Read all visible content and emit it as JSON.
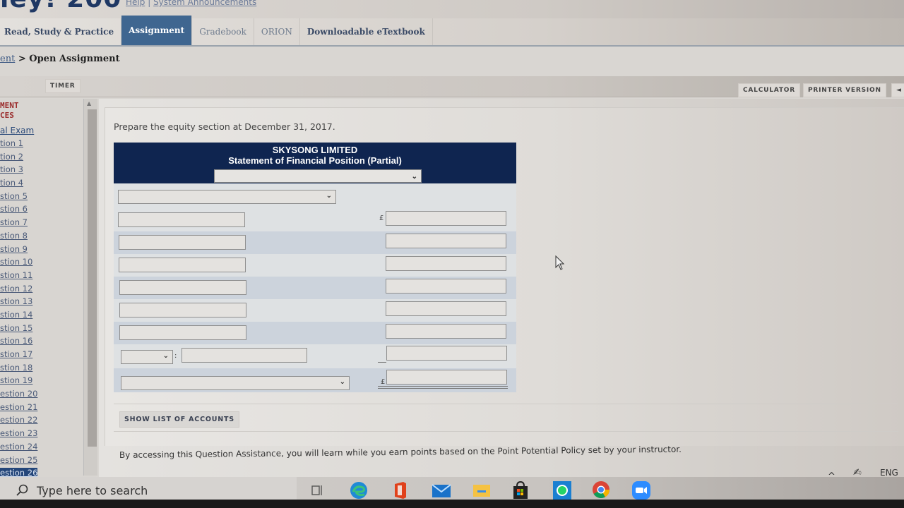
{
  "header": {
    "brand_partial": "ley! 200",
    "links": [
      "Help",
      "System Announcements"
    ],
    "link_separator": "|"
  },
  "nav": {
    "tabs": [
      {
        "label": "Read, Study & Practice",
        "active": false
      },
      {
        "label": "Assignment",
        "active": true
      },
      {
        "label": "Gradebook",
        "active": false
      },
      {
        "label": "ORION",
        "active": false
      },
      {
        "label": "Downloadable eTextbook",
        "active": false
      }
    ]
  },
  "breadcrumb": {
    "parent": "ent",
    "separator": ">",
    "current": "Open Assignment"
  },
  "toolbar": {
    "timer": "TIMER",
    "calculator": "CALCULATOR",
    "printer_version": "PRINTER VERSION",
    "prev_icon": "◄"
  },
  "sidebar": {
    "heading_line1": "MENT",
    "heading_line2": "CES",
    "exam_link": "al Exam",
    "questions": [
      "tion 1",
      "tion 2",
      "tion 3",
      "tion 4",
      "stion 5",
      "stion 6",
      "stion 7",
      "stion 8",
      "stion 9",
      "stion 10",
      "stion 11",
      "stion 12",
      "stion 13",
      "stion 14",
      "stion 15",
      "stion 16",
      "stion 17",
      "stion 18",
      "stion 19",
      "estion 20",
      "estion 21",
      "estion 22",
      "estion 23",
      "estion 24",
      "estion 25",
      "estion 26"
    ],
    "current_index": 25
  },
  "question": {
    "prompt": "Prepare the equity section at December 31, 2017.",
    "company": "SKYSONG LIMITED",
    "statement_title": "Statement of Financial Position (Partial)",
    "date_select_value": "",
    "section_select_value": "",
    "currency_symbol": "£",
    "rows": [
      {
        "account": "",
        "amount": ""
      },
      {
        "account": "",
        "amount": ""
      },
      {
        "account": "",
        "amount": ""
      },
      {
        "account": "",
        "amount": ""
      },
      {
        "account": "",
        "amount": ""
      },
      {
        "account": "",
        "amount": ""
      }
    ],
    "less_row": {
      "select_value": "",
      "separator": ":",
      "account": "",
      "amount": ""
    },
    "total_row": {
      "select_value": "",
      "amount": ""
    },
    "show_accounts_button": "SHOW LIST OF ACCOUNTS",
    "assistance_note": "By accessing this Question Assistance, you will learn while you earn points based on the Point Potential Policy set by your instructor."
  },
  "taskbar": {
    "search_placeholder": "Type here to search",
    "apps": [
      "task-view",
      "edge",
      "office",
      "mail",
      "file-explorer",
      "store",
      "whatsapp",
      "chrome",
      "zoom"
    ],
    "tray_language": "ENG"
  }
}
